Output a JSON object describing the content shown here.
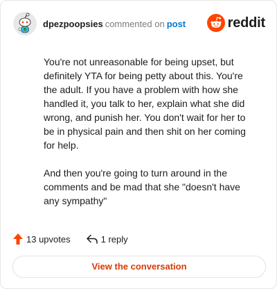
{
  "header": {
    "username": "dpezpoopsies",
    "action_text": "commented on",
    "post_link": "post",
    "brand": "reddit"
  },
  "comment": {
    "paragraphs": [
      "You're not unreasonable for being upset, but definitely YTA for being petty about this. You're the adult. If you have a problem with how she handled it, you talk to her, explain what she did wrong, and punish her. You don't wait for her to be in physical pain and then shit on her coming for help.",
      "And then you're going to turn around in the comments and be mad that she \"doesn't have any sympathy\""
    ]
  },
  "footer": {
    "upvotes": "13 upvotes",
    "replies": "1 reply",
    "view_button": "View the conversation"
  },
  "icons": {
    "avatar": "snoo-avatar-icon",
    "brand": "reddit-logo-icon",
    "upvote": "upvote-arrow-icon",
    "reply": "reply-arrow-icon"
  },
  "colors": {
    "brand_orange": "#ff4500",
    "link_blue": "#0079d3",
    "button_text": "#d93a00",
    "upvote": "#ff4500",
    "muted": "#7c7c7c"
  }
}
